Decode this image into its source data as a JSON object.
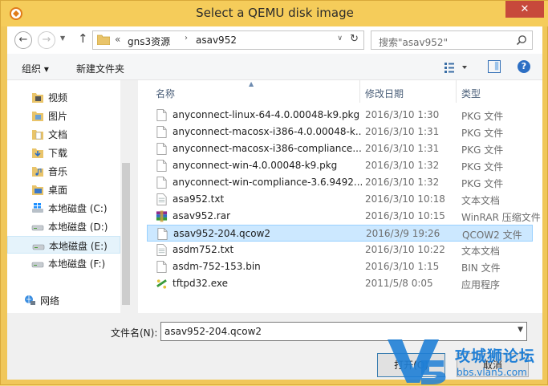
{
  "window": {
    "title": "Select a QEMU disk image",
    "close_label": "✕"
  },
  "toolbar": {
    "address": {
      "overflow": "«",
      "segments": [
        "gns3资源",
        "asav952"
      ]
    },
    "search_placeholder": "搜索\"asav952\""
  },
  "cmdbar": {
    "organize": "组织 ▾",
    "new_folder": "新建文件夹"
  },
  "nav": {
    "items": [
      {
        "label": "视频",
        "icon": "video-folder-icon",
        "selected": false
      },
      {
        "label": "图片",
        "icon": "pictures-folder-icon",
        "selected": false
      },
      {
        "label": "文档",
        "icon": "documents-folder-icon",
        "selected": false
      },
      {
        "label": "下载",
        "icon": "downloads-folder-icon",
        "selected": false
      },
      {
        "label": "音乐",
        "icon": "music-folder-icon",
        "selected": false
      },
      {
        "label": "桌面",
        "icon": "desktop-folder-icon",
        "selected": false
      },
      {
        "label": "本地磁盘 (C:)",
        "icon": "windows-drive-icon",
        "selected": false
      },
      {
        "label": "本地磁盘 (D:)",
        "icon": "drive-icon",
        "selected": false
      },
      {
        "label": "本地磁盘 (E:)",
        "icon": "drive-icon",
        "selected": true
      },
      {
        "label": "本地磁盘 (F:)",
        "icon": "drive-icon",
        "selected": false
      },
      {
        "label": "网络",
        "icon": "network-icon",
        "selected": false
      }
    ]
  },
  "files": {
    "columns": {
      "name": "名称",
      "date": "修改日期",
      "type": "类型"
    },
    "rows": [
      {
        "name": "anyconnect-linux-64-4.0.00048-k9.pkg",
        "date": "2016/3/10 1:30",
        "type": "PKG 文件",
        "icon": "file-icon",
        "selected": false
      },
      {
        "name": "anyconnect-macosx-i386-4.0.00048-k...",
        "date": "2016/3/10 1:31",
        "type": "PKG 文件",
        "icon": "file-icon",
        "selected": false
      },
      {
        "name": "anyconnect-macosx-i386-compliance...",
        "date": "2016/3/10 1:31",
        "type": "PKG 文件",
        "icon": "file-icon",
        "selected": false
      },
      {
        "name": "anyconnect-win-4.0.00048-k9.pkg",
        "date": "2016/3/10 1:32",
        "type": "PKG 文件",
        "icon": "file-icon",
        "selected": false
      },
      {
        "name": "anyconnect-win-compliance-3.6.9492....",
        "date": "2016/3/10 1:32",
        "type": "PKG 文件",
        "icon": "file-icon",
        "selected": false
      },
      {
        "name": "asa952.txt",
        "date": "2016/3/10 10:18",
        "type": "文本文档",
        "icon": "text-file-icon",
        "selected": false
      },
      {
        "name": "asav952.rar",
        "date": "2016/3/10 10:15",
        "type": "WinRAR 压缩文件",
        "icon": "winrar-archive-icon",
        "selected": false
      },
      {
        "name": "asav952-204.qcow2",
        "date": "2016/3/9 19:26",
        "type": "QCOW2 文件",
        "icon": "file-icon",
        "selected": true
      },
      {
        "name": "asdm752.txt",
        "date": "2016/3/10 10:22",
        "type": "文本文档",
        "icon": "text-file-icon",
        "selected": false
      },
      {
        "name": "asdm-752-153.bin",
        "date": "2016/3/10 1:15",
        "type": "BIN 文件",
        "icon": "file-icon",
        "selected": false
      },
      {
        "name": "tftpd32.exe",
        "date": "2011/5/8 0:05",
        "type": "应用程序",
        "icon": "tftpd-app-icon",
        "selected": false
      }
    ]
  },
  "footer": {
    "filename_label": "文件名(N):",
    "filename_value": "asav952-204.qcow2",
    "open_label": "打开(O)",
    "cancel_label": "取消"
  },
  "watermark": {
    "title": "攻城狮论坛",
    "url": "bbs.vlan5.com"
  },
  "colors": {
    "title_bar": "#f5cc5a",
    "selection": "#cce8ff",
    "close": "#c7493b",
    "accent": "#1f7fd6"
  }
}
